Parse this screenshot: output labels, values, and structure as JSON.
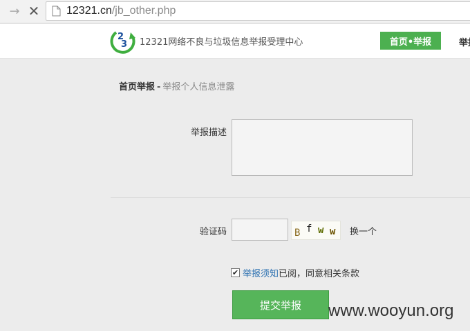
{
  "browser": {
    "url_host": "12321.cn",
    "url_path": "/jb_other.php"
  },
  "header": {
    "site_title": "12321网络不良与垃圾信息举报受理中心",
    "nav": [
      {
        "label": "首页•举报",
        "active": true
      },
      {
        "label": "举报"
      }
    ],
    "accent_color": "#4cb050"
  },
  "breadcrumb": {
    "home": "首页举报",
    "separator": "-",
    "current": "举报个人信息泄露"
  },
  "form": {
    "description_label": "举报描述",
    "description_value": "",
    "captcha_label": "验证码",
    "captcha_value": "",
    "captcha_text": "Bfww",
    "captcha_chars": [
      "B",
      "f",
      "w",
      "w"
    ],
    "refresh_label": "换一个",
    "agree_checked": true,
    "notice_link": "举报须知",
    "agree_text": "已阅，同意相关条款",
    "submit_label": "提交举报"
  },
  "watermark": "www.wooyun.org"
}
